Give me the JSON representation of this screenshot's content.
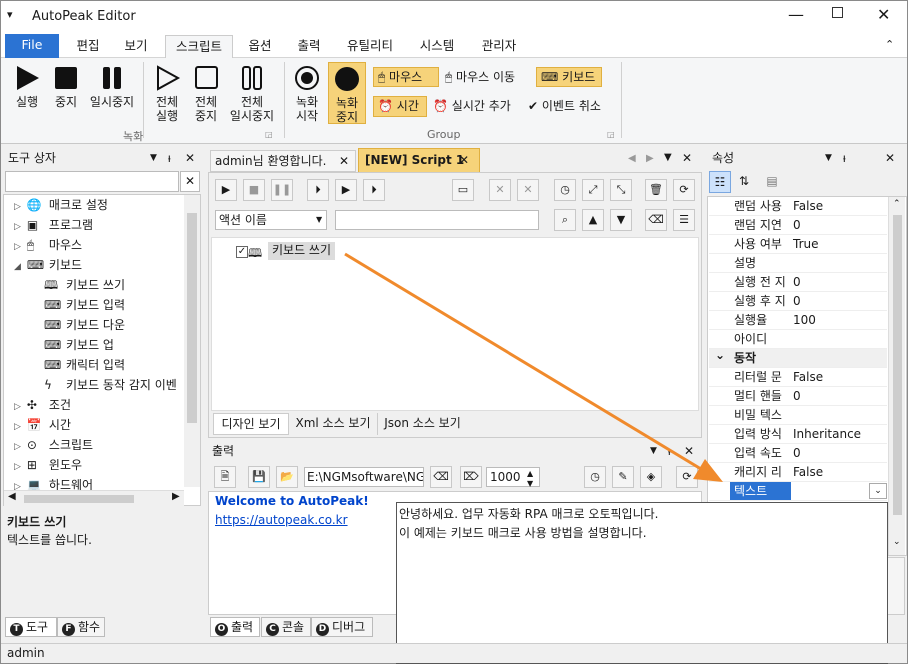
{
  "app": {
    "title": "AutoPeak Editor",
    "status_user": "admin"
  },
  "ribbon_tabs": [
    "File",
    "편집",
    "보기",
    "스크립트",
    "옵션",
    "출력",
    "유틸리티",
    "시스템",
    "관리자"
  ],
  "ribbon": {
    "run": "실행",
    "stop": "중지",
    "pause": "일시중지",
    "run_all": [
      "전체",
      "실행"
    ],
    "stop_all": [
      "전체",
      "중지"
    ],
    "pause_all": [
      "전체",
      "일시중지"
    ],
    "rec_start": [
      "녹화",
      "시작"
    ],
    "rec_stop": [
      "녹화",
      "중지"
    ],
    "mouse": "마우스",
    "mouse_move": "마우스 이동",
    "keyboard": "키보드",
    "time": "시간",
    "realtime_add": "실시간 추가",
    "event_cancel": "이벤트 취소",
    "group_record": "녹화",
    "group_group": "Group"
  },
  "toolbox": {
    "title": "도구 상자",
    "items": [
      {
        "label": "매크로 설정",
        "icon": "globe-icon",
        "indent": 0,
        "exp": "▷"
      },
      {
        "label": "프로그램",
        "icon": "program-icon",
        "indent": 0,
        "exp": "▷"
      },
      {
        "label": "마우스",
        "icon": "mouse-icon",
        "indent": 0,
        "exp": "▷"
      },
      {
        "label": "키보드",
        "icon": "keyboard-icon",
        "indent": 0,
        "exp": "◢"
      },
      {
        "label": "키보드 쓰기",
        "icon": "keyboard-write-icon",
        "indent": 1,
        "exp": ""
      },
      {
        "label": "키보드 입력",
        "icon": "keyboard-icon",
        "indent": 1,
        "exp": ""
      },
      {
        "label": "키보드 다운",
        "icon": "keyboard-down-icon",
        "indent": 1,
        "exp": ""
      },
      {
        "label": "키보드 업",
        "icon": "keyboard-up-icon",
        "indent": 1,
        "exp": ""
      },
      {
        "label": "캐릭터 입력",
        "icon": "char-input-icon",
        "indent": 1,
        "exp": ""
      },
      {
        "label": "키보드 동작 감지 이벤",
        "icon": "lightning-icon",
        "indent": 1,
        "exp": ""
      },
      {
        "label": "조건",
        "icon": "condition-icon",
        "indent": 0,
        "exp": "▷"
      },
      {
        "label": "시간",
        "icon": "calendar-icon",
        "indent": 0,
        "exp": "▷"
      },
      {
        "label": "스크립트",
        "icon": "script-icon",
        "indent": 0,
        "exp": "▷"
      },
      {
        "label": "윈도우",
        "icon": "windows-icon",
        "indent": 0,
        "exp": "▷"
      },
      {
        "label": "하드웨어",
        "icon": "hardware-icon",
        "indent": 0,
        "exp": "▷"
      }
    ],
    "desc_title": "키보드 쓰기",
    "desc_text": "텍스트를 씁니다.",
    "tab_tools": "도구",
    "tab_functions": "함수"
  },
  "editor": {
    "tab1": "admin님 환영합니다.",
    "tab2": "[NEW] Script 1",
    "action_select": "액션 이름",
    "node_label": "키보드 쓰기",
    "view_tabs": [
      "디자인 보기",
      "Xml 소스 보기",
      "Json 소스 보기"
    ]
  },
  "output": {
    "title": "출력",
    "path": "E:\\NGMsoftware\\NG",
    "count": "1000",
    "welcome": "Welcome to AutoPeak!",
    "link": "https://autopeak.co.kr",
    "tabs": [
      "출력",
      "콘솔",
      "디버그"
    ]
  },
  "properties": {
    "title": "속성",
    "rows1": [
      [
        "랜덤 사용",
        "False"
      ],
      [
        "랜덤 지연",
        "0"
      ],
      [
        "사용 여부",
        "True"
      ],
      [
        "설명",
        ""
      ],
      [
        "실행 전 지",
        "0"
      ],
      [
        "실행 후 지",
        "0"
      ],
      [
        "실행율",
        "100"
      ],
      [
        "아이디",
        ""
      ]
    ],
    "section": "동작",
    "rows2": [
      [
        "리터럴 문",
        "False"
      ],
      [
        "멀티 핸들",
        "0"
      ],
      [
        "비밀 텍스",
        ""
      ],
      [
        "입력 방식",
        "Inheritance"
      ],
      [
        "입력 속도",
        "0"
      ],
      [
        "캐리지 리",
        "False"
      ]
    ],
    "selected_key": "텍스트"
  },
  "text_popup": {
    "line1": "안녕하세요. 업무 자동화 RPA 매크로 오토픽입니다.",
    "line2": "이 예제는 키보드 매크로 사용 방법을 설명합니다."
  },
  "colors": {
    "accent": "#2b73d3",
    "highlight": "#f6d37a",
    "arrow": "#f08a2c",
    "link": "#0044cc"
  }
}
